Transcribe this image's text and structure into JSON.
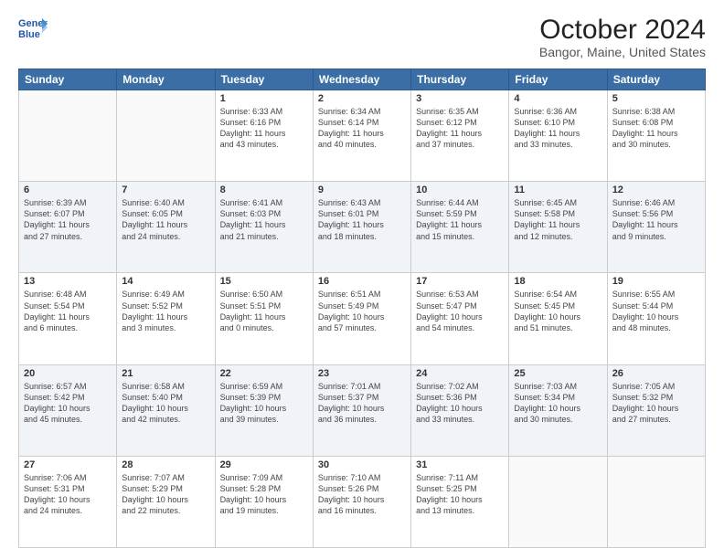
{
  "logo": {
    "line1": "General",
    "line2": "Blue"
  },
  "title": "October 2024",
  "subtitle": "Bangor, Maine, United States",
  "days_of_week": [
    "Sunday",
    "Monday",
    "Tuesday",
    "Wednesday",
    "Thursday",
    "Friday",
    "Saturday"
  ],
  "weeks": [
    [
      {
        "day": "",
        "info": ""
      },
      {
        "day": "",
        "info": ""
      },
      {
        "day": "1",
        "info": "Sunrise: 6:33 AM\nSunset: 6:16 PM\nDaylight: 11 hours\nand 43 minutes."
      },
      {
        "day": "2",
        "info": "Sunrise: 6:34 AM\nSunset: 6:14 PM\nDaylight: 11 hours\nand 40 minutes."
      },
      {
        "day": "3",
        "info": "Sunrise: 6:35 AM\nSunset: 6:12 PM\nDaylight: 11 hours\nand 37 minutes."
      },
      {
        "day": "4",
        "info": "Sunrise: 6:36 AM\nSunset: 6:10 PM\nDaylight: 11 hours\nand 33 minutes."
      },
      {
        "day": "5",
        "info": "Sunrise: 6:38 AM\nSunset: 6:08 PM\nDaylight: 11 hours\nand 30 minutes."
      }
    ],
    [
      {
        "day": "6",
        "info": "Sunrise: 6:39 AM\nSunset: 6:07 PM\nDaylight: 11 hours\nand 27 minutes."
      },
      {
        "day": "7",
        "info": "Sunrise: 6:40 AM\nSunset: 6:05 PM\nDaylight: 11 hours\nand 24 minutes."
      },
      {
        "day": "8",
        "info": "Sunrise: 6:41 AM\nSunset: 6:03 PM\nDaylight: 11 hours\nand 21 minutes."
      },
      {
        "day": "9",
        "info": "Sunrise: 6:43 AM\nSunset: 6:01 PM\nDaylight: 11 hours\nand 18 minutes."
      },
      {
        "day": "10",
        "info": "Sunrise: 6:44 AM\nSunset: 5:59 PM\nDaylight: 11 hours\nand 15 minutes."
      },
      {
        "day": "11",
        "info": "Sunrise: 6:45 AM\nSunset: 5:58 PM\nDaylight: 11 hours\nand 12 minutes."
      },
      {
        "day": "12",
        "info": "Sunrise: 6:46 AM\nSunset: 5:56 PM\nDaylight: 11 hours\nand 9 minutes."
      }
    ],
    [
      {
        "day": "13",
        "info": "Sunrise: 6:48 AM\nSunset: 5:54 PM\nDaylight: 11 hours\nand 6 minutes."
      },
      {
        "day": "14",
        "info": "Sunrise: 6:49 AM\nSunset: 5:52 PM\nDaylight: 11 hours\nand 3 minutes."
      },
      {
        "day": "15",
        "info": "Sunrise: 6:50 AM\nSunset: 5:51 PM\nDaylight: 11 hours\nand 0 minutes."
      },
      {
        "day": "16",
        "info": "Sunrise: 6:51 AM\nSunset: 5:49 PM\nDaylight: 10 hours\nand 57 minutes."
      },
      {
        "day": "17",
        "info": "Sunrise: 6:53 AM\nSunset: 5:47 PM\nDaylight: 10 hours\nand 54 minutes."
      },
      {
        "day": "18",
        "info": "Sunrise: 6:54 AM\nSunset: 5:45 PM\nDaylight: 10 hours\nand 51 minutes."
      },
      {
        "day": "19",
        "info": "Sunrise: 6:55 AM\nSunset: 5:44 PM\nDaylight: 10 hours\nand 48 minutes."
      }
    ],
    [
      {
        "day": "20",
        "info": "Sunrise: 6:57 AM\nSunset: 5:42 PM\nDaylight: 10 hours\nand 45 minutes."
      },
      {
        "day": "21",
        "info": "Sunrise: 6:58 AM\nSunset: 5:40 PM\nDaylight: 10 hours\nand 42 minutes."
      },
      {
        "day": "22",
        "info": "Sunrise: 6:59 AM\nSunset: 5:39 PM\nDaylight: 10 hours\nand 39 minutes."
      },
      {
        "day": "23",
        "info": "Sunrise: 7:01 AM\nSunset: 5:37 PM\nDaylight: 10 hours\nand 36 minutes."
      },
      {
        "day": "24",
        "info": "Sunrise: 7:02 AM\nSunset: 5:36 PM\nDaylight: 10 hours\nand 33 minutes."
      },
      {
        "day": "25",
        "info": "Sunrise: 7:03 AM\nSunset: 5:34 PM\nDaylight: 10 hours\nand 30 minutes."
      },
      {
        "day": "26",
        "info": "Sunrise: 7:05 AM\nSunset: 5:32 PM\nDaylight: 10 hours\nand 27 minutes."
      }
    ],
    [
      {
        "day": "27",
        "info": "Sunrise: 7:06 AM\nSunset: 5:31 PM\nDaylight: 10 hours\nand 24 minutes."
      },
      {
        "day": "28",
        "info": "Sunrise: 7:07 AM\nSunset: 5:29 PM\nDaylight: 10 hours\nand 22 minutes."
      },
      {
        "day": "29",
        "info": "Sunrise: 7:09 AM\nSunset: 5:28 PM\nDaylight: 10 hours\nand 19 minutes."
      },
      {
        "day": "30",
        "info": "Sunrise: 7:10 AM\nSunset: 5:26 PM\nDaylight: 10 hours\nand 16 minutes."
      },
      {
        "day": "31",
        "info": "Sunrise: 7:11 AM\nSunset: 5:25 PM\nDaylight: 10 hours\nand 13 minutes."
      },
      {
        "day": "",
        "info": ""
      },
      {
        "day": "",
        "info": ""
      }
    ]
  ]
}
